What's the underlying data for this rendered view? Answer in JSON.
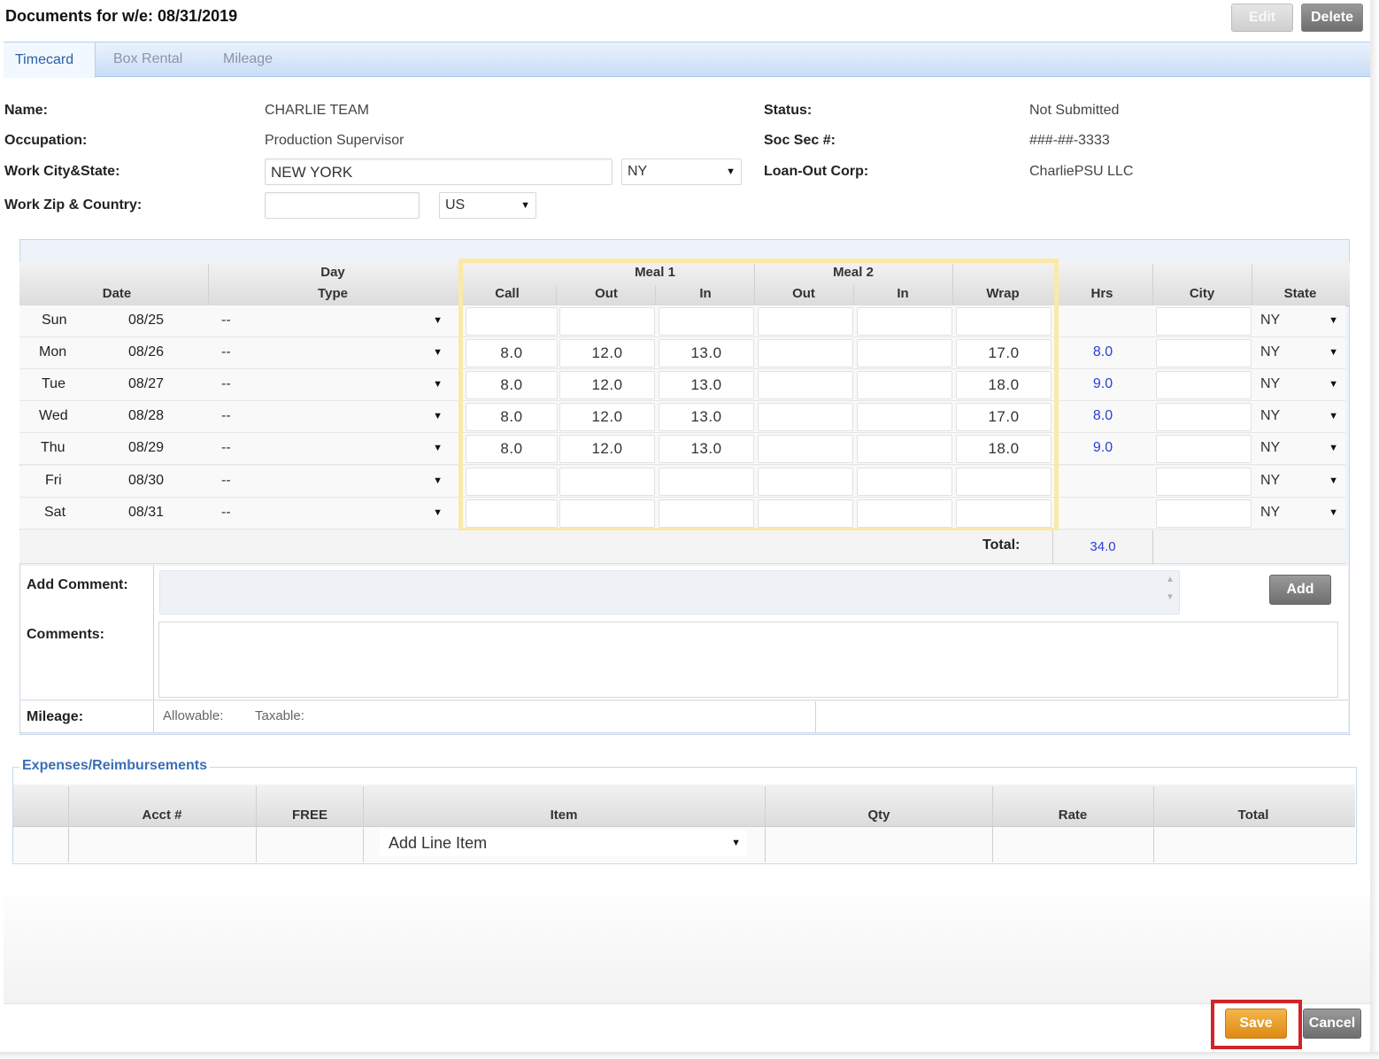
{
  "header": {
    "title": "Documents for w/e: 08/31/2019",
    "edit_label": "Edit",
    "delete_label": "Delete"
  },
  "tabs": [
    {
      "label": "Timecard",
      "active": true
    },
    {
      "label": "Box Rental",
      "active": false
    },
    {
      "label": "Mileage",
      "active": false
    }
  ],
  "info": {
    "name_label": "Name:",
    "name_value": "CHARLIE TEAM",
    "occupation_label": "Occupation:",
    "occupation_value": "Production Supervisor",
    "work_city_label": "Work City&State:",
    "work_city_value": "NEW YORK",
    "work_state_value": "NY",
    "work_zip_label": "Work Zip & Country:",
    "work_zip_value": "",
    "country_value": "US",
    "status_label": "Status:",
    "status_value": "Not Submitted",
    "ssn_label": "Soc Sec #:",
    "ssn_value": "###-##-3333",
    "loanout_label": "Loan-Out Corp:",
    "loanout_value": "CharliePSU LLC"
  },
  "timecard": {
    "headers": {
      "date": "Date",
      "day_top": "Day",
      "day_type": "Type",
      "meal1": "Meal 1",
      "meal2": "Meal 2",
      "call": "Call",
      "out1": "Out",
      "in1": "In",
      "out2": "Out",
      "in2": "In",
      "wrap": "Wrap",
      "hrs": "Hrs",
      "city": "City",
      "state": "State"
    },
    "rows": [
      {
        "day": "Sun",
        "date": "08/25",
        "type": "--",
        "call": "",
        "out1": "",
        "in1": "",
        "out2": "",
        "in2": "",
        "wrap": "",
        "hrs": "",
        "city": "",
        "state": "NY"
      },
      {
        "day": "Mon",
        "date": "08/26",
        "type": "--",
        "call": "8.0",
        "out1": "12.0",
        "in1": "13.0",
        "out2": "",
        "in2": "",
        "wrap": "17.0",
        "hrs": "8.0",
        "city": "",
        "state": "NY"
      },
      {
        "day": "Tue",
        "date": "08/27",
        "type": "--",
        "call": "8.0",
        "out1": "12.0",
        "in1": "13.0",
        "out2": "",
        "in2": "",
        "wrap": "18.0",
        "hrs": "9.0",
        "city": "",
        "state": "NY"
      },
      {
        "day": "Wed",
        "date": "08/28",
        "type": "--",
        "call": "8.0",
        "out1": "12.0",
        "in1": "13.0",
        "out2": "",
        "in2": "",
        "wrap": "17.0",
        "hrs": "8.0",
        "city": "",
        "state": "NY"
      },
      {
        "day": "Thu",
        "date": "08/29",
        "type": "--",
        "call": "8.0",
        "out1": "12.0",
        "in1": "13.0",
        "out2": "",
        "in2": "",
        "wrap": "18.0",
        "hrs": "9.0",
        "city": "",
        "state": "NY"
      },
      {
        "day": "Fri",
        "date": "08/30",
        "type": "--",
        "call": "",
        "out1": "",
        "in1": "",
        "out2": "",
        "in2": "",
        "wrap": "",
        "hrs": "",
        "city": "",
        "state": "NY"
      },
      {
        "day": "Sat",
        "date": "08/31",
        "type": "--",
        "call": "",
        "out1": "",
        "in1": "",
        "out2": "",
        "in2": "",
        "wrap": "",
        "hrs": "",
        "city": "",
        "state": "NY"
      }
    ],
    "total_label": "Total:",
    "total_value": "34.0"
  },
  "comments": {
    "add_comment_label": "Add Comment:",
    "add_button": "Add",
    "comments_label": "Comments:",
    "mileage_label": "Mileage:",
    "allowable_label": "Allowable:",
    "taxable_label": "Taxable:"
  },
  "expenses": {
    "legend": "Expenses/Reimbursements",
    "headers": {
      "acct": "Acct #",
      "free": "FREE",
      "item": "Item",
      "qty": "Qty",
      "rate": "Rate",
      "total": "Total"
    },
    "item_select": "Add Line Item"
  },
  "footer": {
    "save_label": "Save",
    "cancel_label": "Cancel"
  },
  "colors": {
    "accent_blue": "#2a5fa8",
    "hrs_blue": "#2a3fd6",
    "save_orange": "#de8a14",
    "highlight_red": "#d2232a",
    "meal_highlight": "#fbe9a8"
  }
}
